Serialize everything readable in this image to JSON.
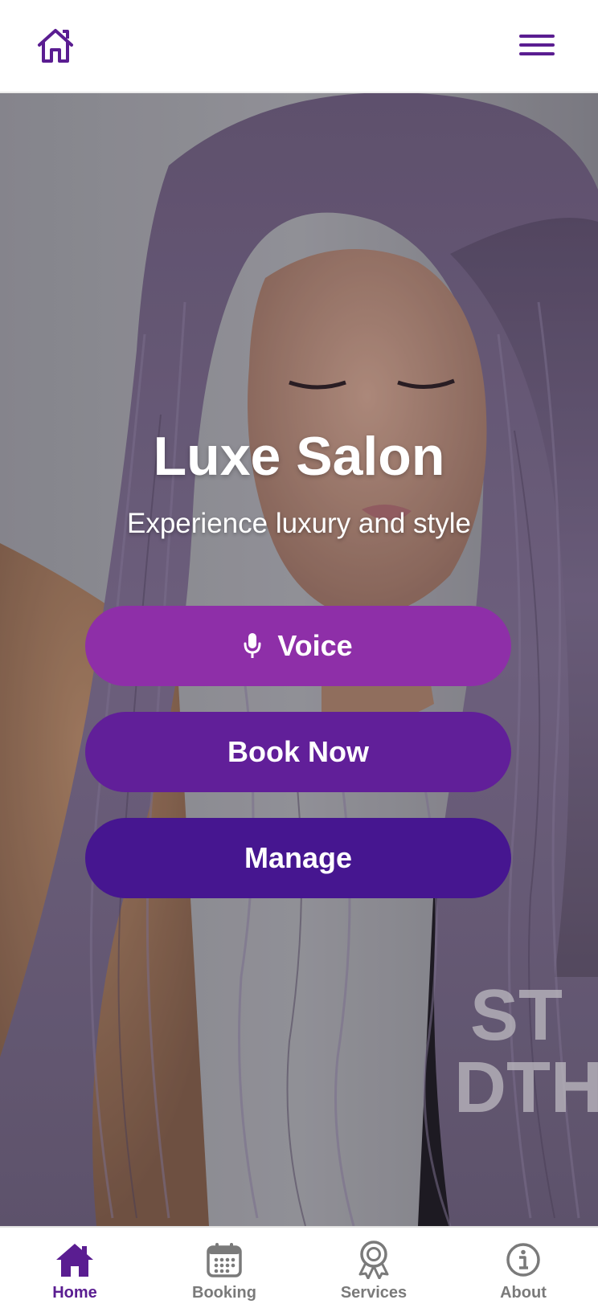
{
  "header": {
    "home_icon": "home-outline-icon",
    "menu_icon": "hamburger-menu-icon"
  },
  "colors": {
    "primary": "#5a1d91",
    "voice_button": "#8e2fa8",
    "book_button": "#611f99",
    "manage_button": "#461690",
    "inactive_nav": "#7a7a7a"
  },
  "hero": {
    "title": "Luxe Salon",
    "subtitle": "Experience luxury and style",
    "background": "photo of woman with long lavender-purple wavy hair"
  },
  "actions": {
    "voice_label": "Voice",
    "voice_icon": "microphone-icon",
    "book_label": "Book Now",
    "manage_label": "Manage"
  },
  "bottom_nav": {
    "items": [
      {
        "label": "Home",
        "icon": "home-filled-icon",
        "active": true
      },
      {
        "label": "Booking",
        "icon": "calendar-icon",
        "active": false
      },
      {
        "label": "Services",
        "icon": "award-ribbon-icon",
        "active": false
      },
      {
        "label": "About",
        "icon": "info-circle-icon",
        "active": false
      }
    ]
  }
}
